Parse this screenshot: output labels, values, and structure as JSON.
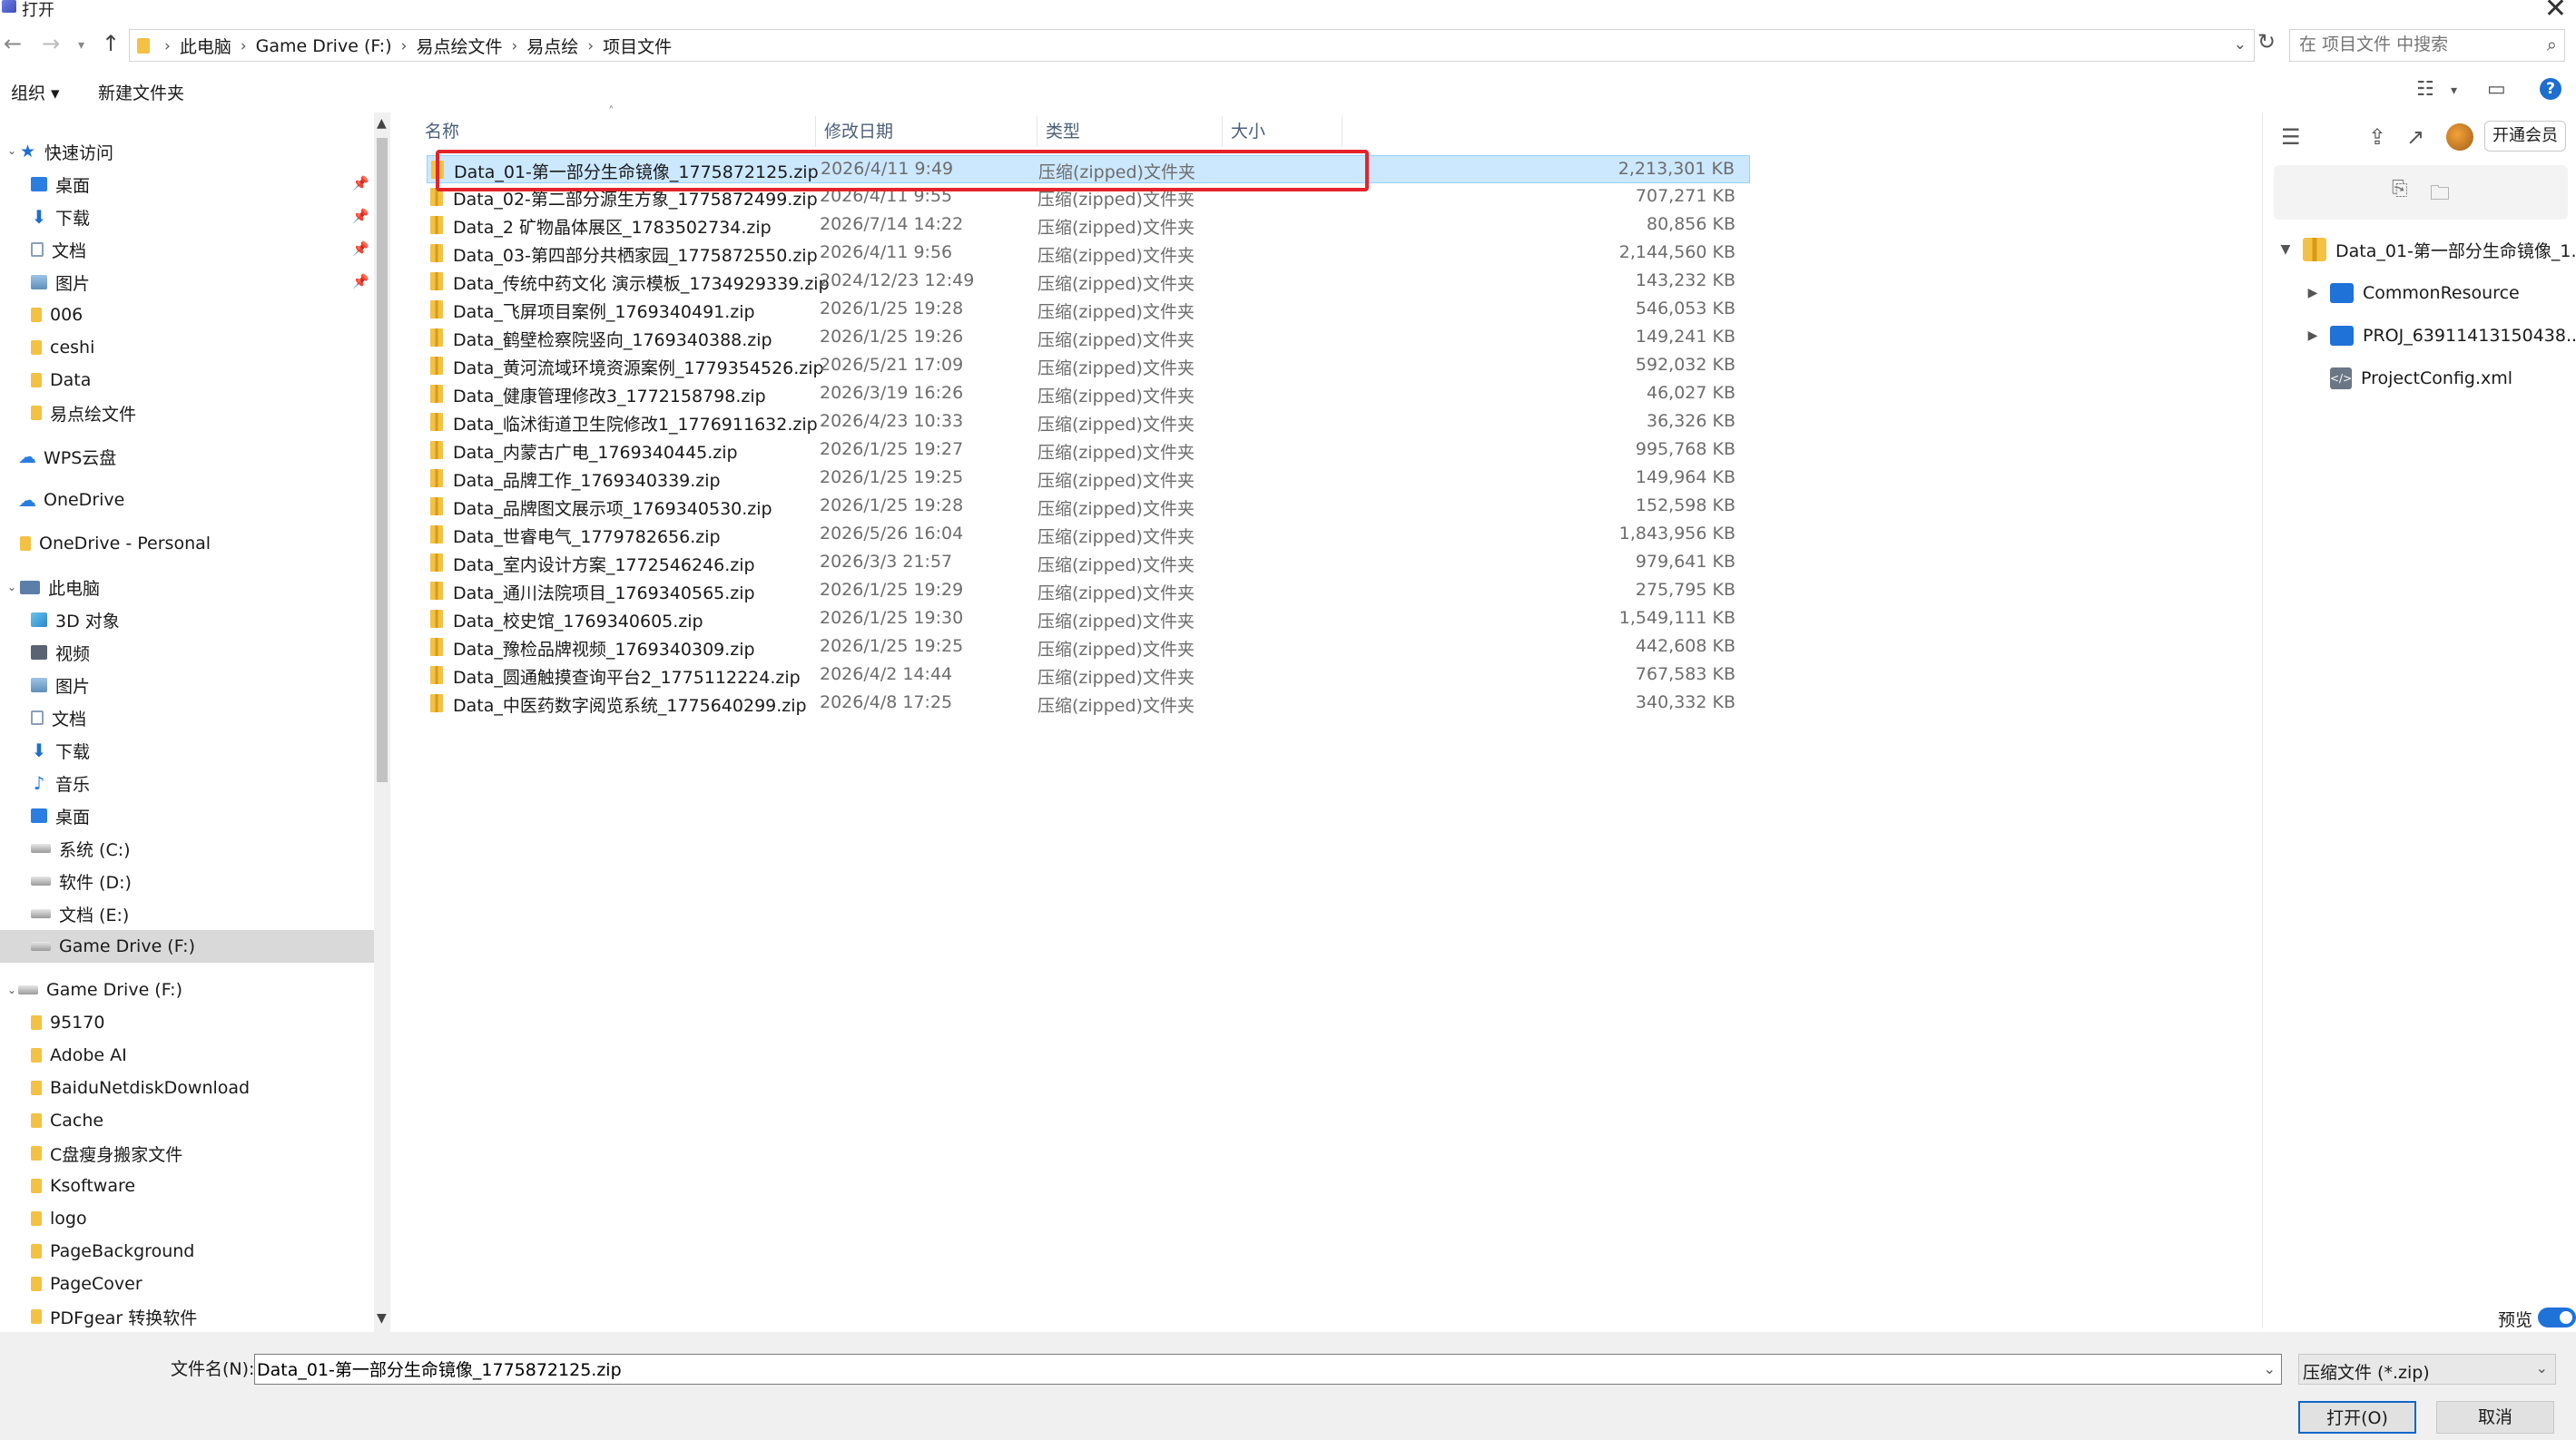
{
  "window": {
    "title": "打开"
  },
  "address": {
    "crumbs": [
      "此电脑",
      "Game Drive (F:)",
      "易点绘文件",
      "易点绘",
      "项目文件"
    ]
  },
  "search": {
    "placeholder": "在 项目文件 中搜索"
  },
  "toolbar": {
    "organize": "组织 ▾",
    "new_folder": "新建文件夹"
  },
  "nav": {
    "quick_access": "快速访问",
    "quick_items": [
      "桌面",
      "下载",
      "文档",
      "图片",
      "006",
      "ceshi",
      "Data",
      "易点绘文件"
    ],
    "wps": "WPS云盘",
    "onedrive": "OneDrive",
    "onedrive_personal": "OneDrive - Personal",
    "this_pc": "此电脑",
    "pc_items": [
      "3D 对象",
      "视频",
      "图片",
      "文档",
      "下载",
      "音乐",
      "桌面",
      "系统 (C:)",
      "软件 (D:)",
      "文档 (E:)",
      "Game Drive (F:)"
    ],
    "game_drive": "Game Drive (F:)",
    "drive_items": [
      "95170",
      "Adobe AI",
      "BaiduNetdiskDownload",
      "Cache",
      "C盘瘦身搬家文件",
      "Ksoftware",
      "logo",
      "PageBackground",
      "PageCover",
      "PDFgear 转换软件"
    ]
  },
  "columns": {
    "name": "名称",
    "date": "修改日期",
    "type": "类型",
    "size": "大小"
  },
  "files": [
    {
      "name": "Data_01-第一部分生命镜像_1775872125.zip",
      "date": "2026/4/11 9:49",
      "type": "压缩(zipped)文件夹",
      "size": "2,213,301 KB"
    },
    {
      "name": "Data_02-第二部分源生方象_1775872499.zip",
      "date": "2026/4/11 9:55",
      "type": "压缩(zipped)文件夹",
      "size": "707,271 KB"
    },
    {
      "name": "Data_2 矿物晶体展区_1783502734.zip",
      "date": "2026/7/14 14:22",
      "type": "压缩(zipped)文件夹",
      "size": "80,856 KB"
    },
    {
      "name": "Data_03-第四部分共栖家园_1775872550.zip",
      "date": "2026/4/11 9:56",
      "type": "压缩(zipped)文件夹",
      "size": "2,144,560 KB"
    },
    {
      "name": "Data_传统中药文化 演示模板_1734929339.zip",
      "date": "2024/12/23 12:49",
      "type": "压缩(zipped)文件夹",
      "size": "143,232 KB"
    },
    {
      "name": "Data_飞屏项目案例_1769340491.zip",
      "date": "2026/1/25 19:28",
      "type": "压缩(zipped)文件夹",
      "size": "546,053 KB"
    },
    {
      "name": "Data_鹤壁检察院竖向_1769340388.zip",
      "date": "2026/1/25 19:26",
      "type": "压缩(zipped)文件夹",
      "size": "149,241 KB"
    },
    {
      "name": "Data_黄河流域环境资源案例_1779354526.zip",
      "date": "2026/5/21 17:09",
      "type": "压缩(zipped)文件夹",
      "size": "592,032 KB"
    },
    {
      "name": "Data_健康管理修改3_1772158798.zip",
      "date": "2026/3/19 16:26",
      "type": "压缩(zipped)文件夹",
      "size": "46,027 KB"
    },
    {
      "name": "Data_临沭街道卫生院修改1_1776911632.zip",
      "date": "2026/4/23 10:33",
      "type": "压缩(zipped)文件夹",
      "size": "36,326 KB"
    },
    {
      "name": "Data_内蒙古广电_1769340445.zip",
      "date": "2026/1/25 19:27",
      "type": "压缩(zipped)文件夹",
      "size": "995,768 KB"
    },
    {
      "name": "Data_品牌工作_1769340339.zip",
      "date": "2026/1/25 19:25",
      "type": "压缩(zipped)文件夹",
      "size": "149,964 KB"
    },
    {
      "name": "Data_品牌图文展示项_1769340530.zip",
      "date": "2026/1/25 19:28",
      "type": "压缩(zipped)文件夹",
      "size": "152,598 KB"
    },
    {
      "name": "Data_世睿电气_1779782656.zip",
      "date": "2026/5/26 16:04",
      "type": "压缩(zipped)文件夹",
      "size": "1,843,956 KB"
    },
    {
      "name": "Data_室内设计方案_1772546246.zip",
      "date": "2026/3/3 21:57",
      "type": "压缩(zipped)文件夹",
      "size": "979,641 KB"
    },
    {
      "name": "Data_通川法院项目_1769340565.zip",
      "date": "2026/1/25 19:29",
      "type": "压缩(zipped)文件夹",
      "size": "275,795 KB"
    },
    {
      "name": "Data_校史馆_1769340605.zip",
      "date": "2026/1/25 19:30",
      "type": "压缩(zipped)文件夹",
      "size": "1,549,111 KB"
    },
    {
      "name": "Data_豫检品牌视频_1769340309.zip",
      "date": "2026/1/25 19:25",
      "type": "压缩(zipped)文件夹",
      "size": "442,608 KB"
    },
    {
      "name": "Data_圆通触摸查询平台2_1775112224.zip",
      "date": "2026/4/2 14:44",
      "type": "压缩(zipped)文件夹",
      "size": "767,583 KB"
    },
    {
      "name": "Data_中医药数字阅览系统_1775640299.zip",
      "date": "2026/4/8 17:25",
      "type": "压缩(zipped)文件夹",
      "size": "340,332 KB"
    }
  ],
  "preview": {
    "vip_button": "开通会员",
    "tree_root": "Data_01-第一部分生命镜像_1...",
    "tree_children": [
      "CommonResource",
      "PROJ_63911413150438...",
      "ProjectConfig.xml"
    ],
    "toggle_label": "预览"
  },
  "footer": {
    "filename_label": "文件名(N):",
    "filename_value": "Data_01-第一部分生命镜像_1775872125.zip",
    "filetype": "压缩文件 (*.zip)",
    "open_button": "打开(O)",
    "cancel_button": "取消"
  }
}
